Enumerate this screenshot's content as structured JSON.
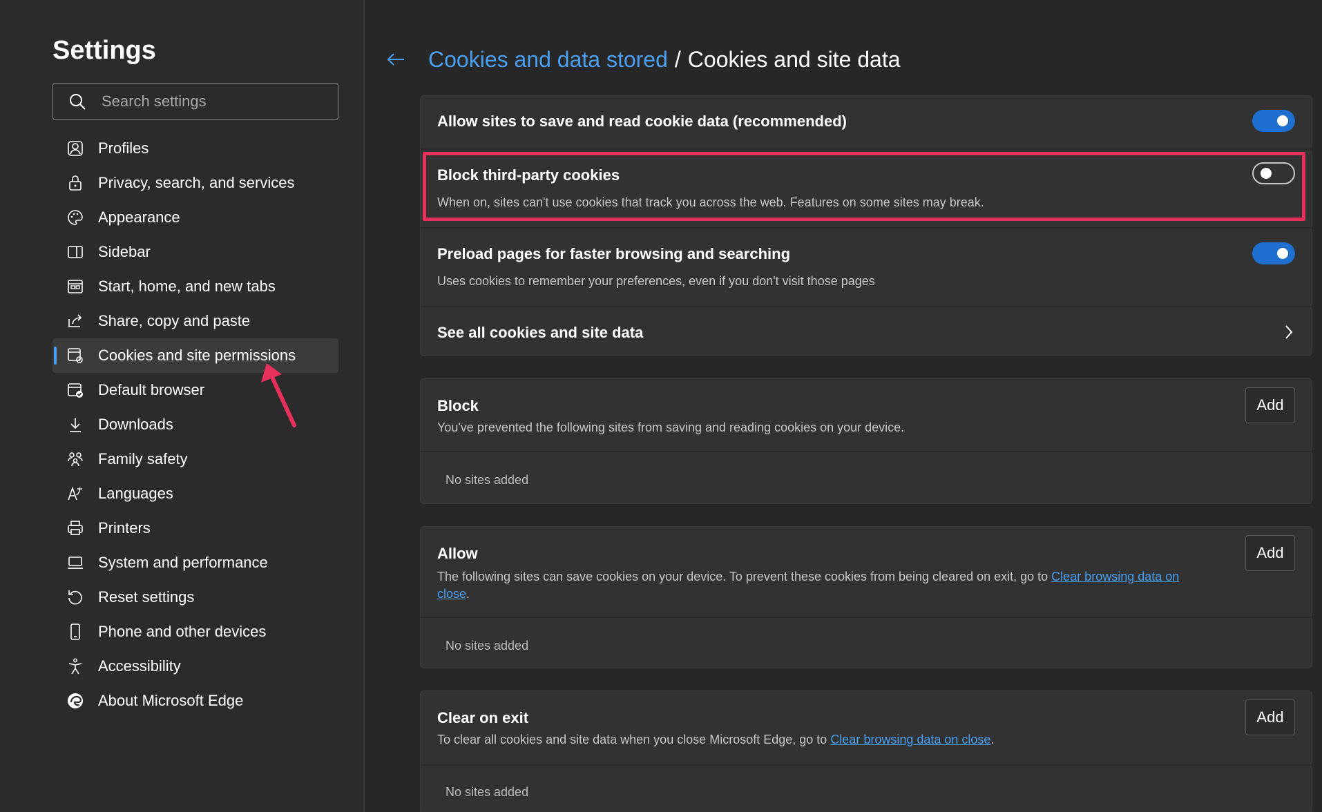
{
  "sidebar": {
    "title": "Settings",
    "search_placeholder": "Search settings",
    "items": [
      {
        "label": "Profiles",
        "icon": "profile-icon"
      },
      {
        "label": "Privacy, search, and services",
        "icon": "lock-icon"
      },
      {
        "label": "Appearance",
        "icon": "palette-icon"
      },
      {
        "label": "Sidebar",
        "icon": "sidebar-icon"
      },
      {
        "label": "Start, home, and new tabs",
        "icon": "home-tabs-icon"
      },
      {
        "label": "Share, copy and paste",
        "icon": "share-icon"
      },
      {
        "label": "Cookies and site permissions",
        "icon": "cookie-permissions-icon",
        "active": true
      },
      {
        "label": "Default browser",
        "icon": "default-browser-icon"
      },
      {
        "label": "Downloads",
        "icon": "download-icon"
      },
      {
        "label": "Family safety",
        "icon": "family-icon"
      },
      {
        "label": "Languages",
        "icon": "language-icon"
      },
      {
        "label": "Printers",
        "icon": "printer-icon"
      },
      {
        "label": "System and performance",
        "icon": "laptop-icon"
      },
      {
        "label": "Reset settings",
        "icon": "reset-icon"
      },
      {
        "label": "Phone and other devices",
        "icon": "phone-icon"
      },
      {
        "label": "Accessibility",
        "icon": "accessibility-icon"
      },
      {
        "label": "About Microsoft Edge",
        "icon": "edge-logo-icon"
      }
    ]
  },
  "breadcrumb": {
    "parent": "Cookies and data stored",
    "separator": "/",
    "current": "Cookies and site data"
  },
  "settings": {
    "allow_sites": {
      "title": "Allow sites to save and read cookie data (recommended)",
      "enabled": true
    },
    "block_third_party": {
      "title": "Block third-party cookies",
      "description": "When on, sites can't use cookies that track you across the web. Features on some sites may break.",
      "enabled": false
    },
    "preload": {
      "title": "Preload pages for faster browsing and searching",
      "description": "Uses cookies to remember your preferences, even if you don't visit those pages",
      "enabled": true
    },
    "see_all": {
      "title": "See all cookies and site data"
    }
  },
  "block_section": {
    "title": "Block",
    "description": "You've prevented the following sites from saving and reading cookies on your device.",
    "add_label": "Add",
    "empty": "No sites added"
  },
  "allow_section": {
    "title": "Allow",
    "description_prefix": "The following sites can save cookies on your device. To prevent these cookies from being cleared on exit, go to ",
    "link_part1": "Clear browsing data on",
    "link_part2": "close",
    "description_suffix": ".",
    "add_label": "Add",
    "empty": "No sites added"
  },
  "clear_section": {
    "title": "Clear on exit",
    "description_prefix": "To clear all cookies and site data when you close Microsoft Edge, go to ",
    "link": "Clear browsing data on close",
    "description_suffix": ".",
    "add_label": "Add",
    "empty": "No sites added"
  },
  "colors": {
    "accent": "#4aa0f2",
    "toggle_on": "#1f6fd0",
    "highlight": "#e8305c",
    "background": "#272727"
  }
}
